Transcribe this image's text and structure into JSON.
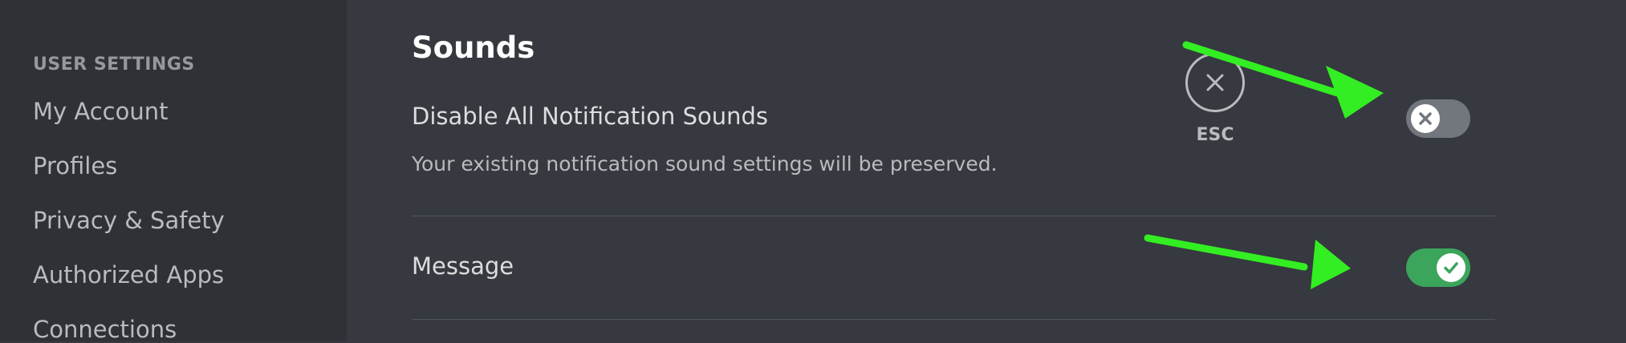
{
  "sidebar": {
    "heading": "USER SETTINGS",
    "items": [
      {
        "label": "My Account"
      },
      {
        "label": "Profiles"
      },
      {
        "label": "Privacy & Safety"
      },
      {
        "label": "Authorized Apps"
      },
      {
        "label": "Connections"
      }
    ]
  },
  "main": {
    "section_title": "Sounds",
    "settings": [
      {
        "label": "Disable All Notification Sounds",
        "description": "Your existing notification sound settings will be preserved.",
        "enabled": false,
        "knob_icon": "x-icon"
      },
      {
        "label": "Message",
        "enabled": true,
        "knob_icon": "check-icon"
      }
    ]
  },
  "close": {
    "label": "ESC",
    "icon": "close-icon"
  },
  "annotations": {
    "arrow_color": "#33ee22"
  },
  "colors": {
    "background": "#36393f",
    "sidebar": "#2f3136",
    "toggle_on": "#3ba55c",
    "toggle_off": "#72767d"
  }
}
